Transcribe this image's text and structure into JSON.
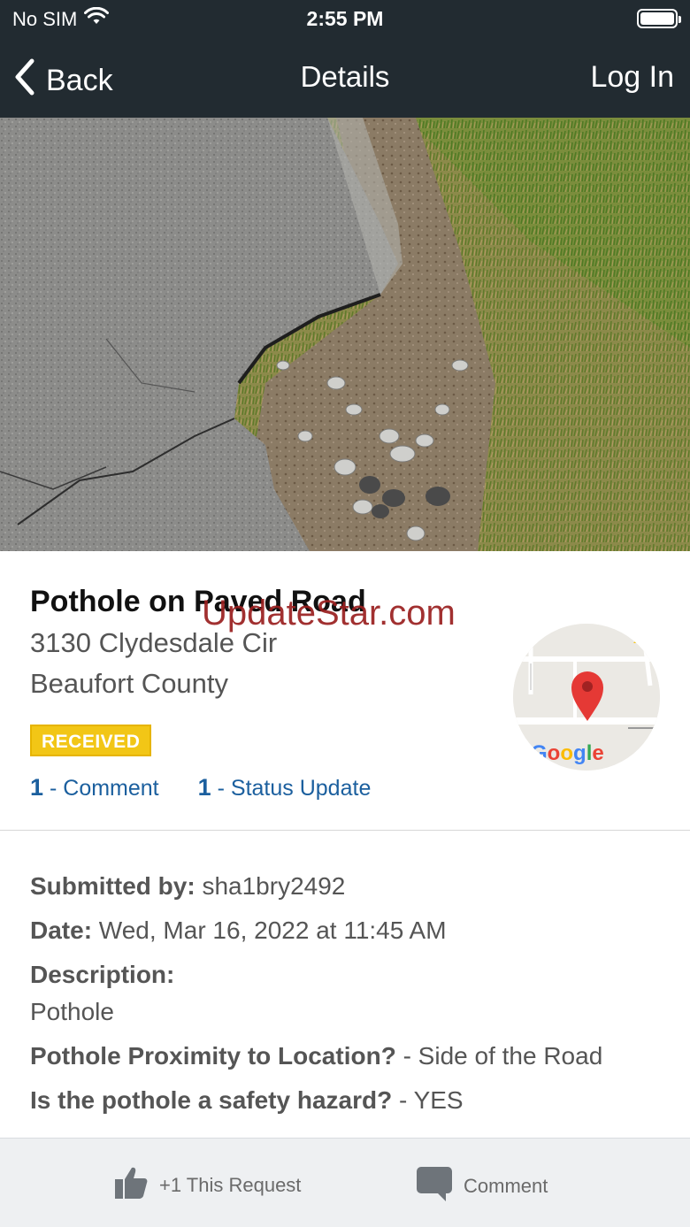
{
  "status_bar": {
    "carrier": "No SIM",
    "time": "2:55 PM",
    "wifi_icon": "wifi-icon",
    "battery_icon": "battery-icon"
  },
  "nav": {
    "back_label": "Back",
    "title": "Details",
    "login_label": "Log In"
  },
  "request": {
    "title": "Pothole on Paved Road",
    "address_line1": "3130 Clydesdale Cir",
    "address_line2": "Beaufort County",
    "status_badge": "RECEIVED",
    "comment_count": "1",
    "comment_label": "Comment",
    "status_update_count": "1",
    "status_update_label": "Status Update",
    "link_separator": "-"
  },
  "watermark": "UpdateStar.com",
  "map": {
    "provider_text": "Google",
    "pin_icon": "map-pin-icon"
  },
  "details": {
    "submitted_by_label": "Submitted by:",
    "submitted_by_value": "sha1bry2492",
    "date_label": "Date:",
    "date_value": "Wed, Mar 16, 2022 at 11:45 AM",
    "description_label": "Description:",
    "description_value": "Pothole",
    "q1_label": "Pothole Proximity to Location?",
    "q1_value": "- Side of the Road",
    "q2_label": "Is the pothole a safety hazard?",
    "q2_value": "- YES"
  },
  "actions": {
    "like_label": "+1 This Request",
    "like_icon": "thumbs-up-icon",
    "comment_label": "Comment",
    "comment_icon": "comment-bubble-icon"
  },
  "colors": {
    "nav_bg": "#222b31",
    "badge_bg": "#f2c616",
    "link": "#1b5f9e",
    "action_bar_bg": "#eef0f2",
    "map_pin": "#e53935"
  }
}
